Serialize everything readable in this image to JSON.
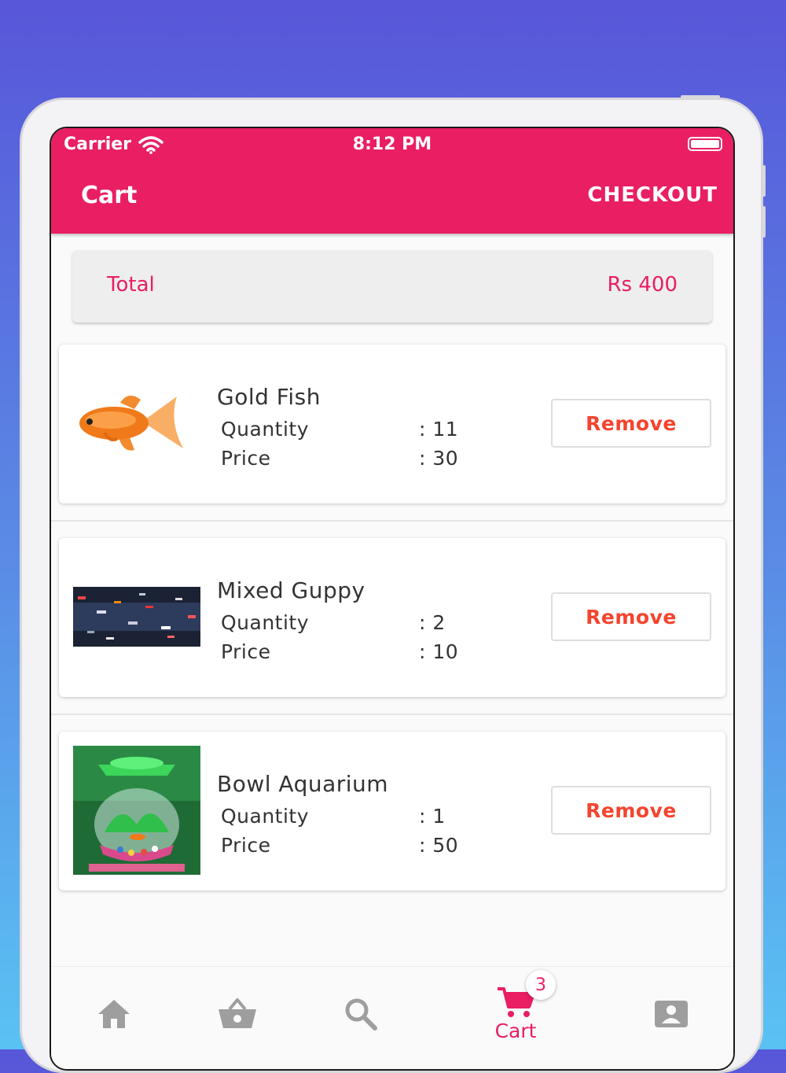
{
  "status_bar": {
    "carrier": "Carrier",
    "time": "8:12 PM"
  },
  "header": {
    "title": "Cart",
    "checkout_label": "CHECKOUT"
  },
  "summary": {
    "total_label": "Total",
    "total_value": "Rs 400"
  },
  "items": [
    {
      "name": "Gold Fish",
      "quantity_label": "Quantity",
      "quantity_value": ": 11",
      "price_label": "Price",
      "price_value": ": 30",
      "remove_label": "Remove"
    },
    {
      "name": "Mixed Guppy",
      "quantity_label": "Quantity",
      "quantity_value": ": 2",
      "price_label": "Price",
      "price_value": ": 10",
      "remove_label": "Remove"
    },
    {
      "name": "Bowl Aquarium",
      "quantity_label": "Quantity",
      "quantity_value": ": 1",
      "price_label": "Price",
      "price_value": ": 50",
      "remove_label": "Remove"
    }
  ],
  "bottom_nav": {
    "items": [
      {
        "icon": "home-icon",
        "label": ""
      },
      {
        "icon": "basket-icon",
        "label": ""
      },
      {
        "icon": "search-icon",
        "label": ""
      },
      {
        "icon": "cart-icon",
        "label": "Cart",
        "active": true
      },
      {
        "icon": "account-icon",
        "label": ""
      }
    ],
    "cart_badge": "3"
  },
  "colors": {
    "primary": "#e91e63",
    "remove_text": "#f4442e",
    "inactive_icon": "#9e9e9e",
    "background": "#fafafa"
  }
}
